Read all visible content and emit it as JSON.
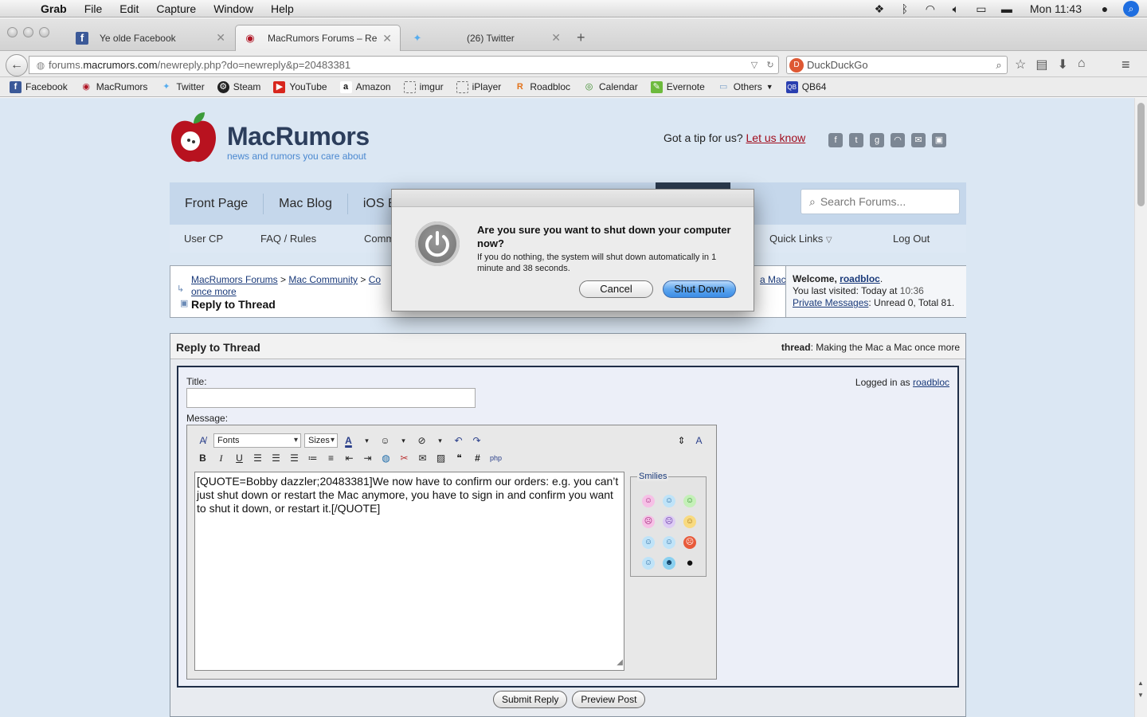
{
  "menubar": {
    "app": "Grab",
    "items": [
      "File",
      "Edit",
      "Capture",
      "Window",
      "Help"
    ],
    "clock": "Mon 11:43"
  },
  "tabs": [
    {
      "title": "Ye olde Facebook",
      "icon": "facebook-icon"
    },
    {
      "title": "MacRumors Forums – Rep...",
      "icon": "macrumors-icon"
    },
    {
      "title": "(26) Twitter",
      "icon": "twitter-icon"
    }
  ],
  "url": {
    "prefix": "forums.",
    "domain": "macrumors.com",
    "path": "/newreply.php?do=newreply&p=20483381"
  },
  "search_engine": {
    "placeholder": "DuckDuckGo"
  },
  "bookmarks": [
    "Facebook",
    "MacRumors",
    "Twitter",
    "Steam",
    "YouTube",
    "Amazon",
    "imgur",
    "iPlayer",
    "Roadbloc",
    "Calendar",
    "Evernote",
    "Others",
    "QB64"
  ],
  "site": {
    "brand": "MacRumors",
    "tagline": "news and rumors you care about",
    "tip_text": "Got a tip for us?",
    "tip_link": "Let us know",
    "main_nav": [
      "Front Page",
      "Mac Blog",
      "iOS B"
    ],
    "sub_nav": [
      "User CP",
      "FAQ / Rules",
      "Comm",
      "Quick Links",
      "Log Out"
    ],
    "search_placeholder": "Search Forums..."
  },
  "breadcrumb": {
    "items": [
      "MacRumors Forums",
      "Mac Community",
      "Co"
    ],
    "tail": "a Mac",
    "second_line": "once more",
    "title": "Reply to Thread"
  },
  "welcome": {
    "label": "Welcome,",
    "user": "roadbloc",
    "last_visit_label": "You last visited: Today at",
    "last_visit_time": "10:36",
    "pm_link": "Private Messages",
    "pm_status": ": Unread 0, Total 81."
  },
  "reply": {
    "header": "Reply to Thread",
    "thread_label": "thread",
    "thread_name": ": Making the Mac a Mac once more",
    "title_label": "Title:",
    "message_label": "Message:",
    "logged_in_label": "Logged in as",
    "logged_in_user": "roadbloc",
    "fonts_select": "Fonts",
    "sizes_select": "Sizes",
    "message_text": "[QUOTE=Bobby dazzler;20483381]We now have to confirm our orders: e.g. you can’t just shut down or restart the Mac anymore, you have to sign in and confirm you want to shut it down, or restart it.[/QUOTE]",
    "smilies_label": "Smilies",
    "submit_label": "Submit Reply",
    "preview_label": "Preview Post"
  },
  "dialog": {
    "title": "Are you sure you want to shut down your computer now?",
    "subtitle": "If you do nothing, the system will shut down automatically in 1 minute and 38 seconds.",
    "cancel": "Cancel",
    "confirm": "Shut Down"
  },
  "colors": {
    "accent": "#3a8ce6",
    "link": "#1a3a7a",
    "page_bg": "#dbe7f3",
    "brand_red": "#a10d1d"
  }
}
